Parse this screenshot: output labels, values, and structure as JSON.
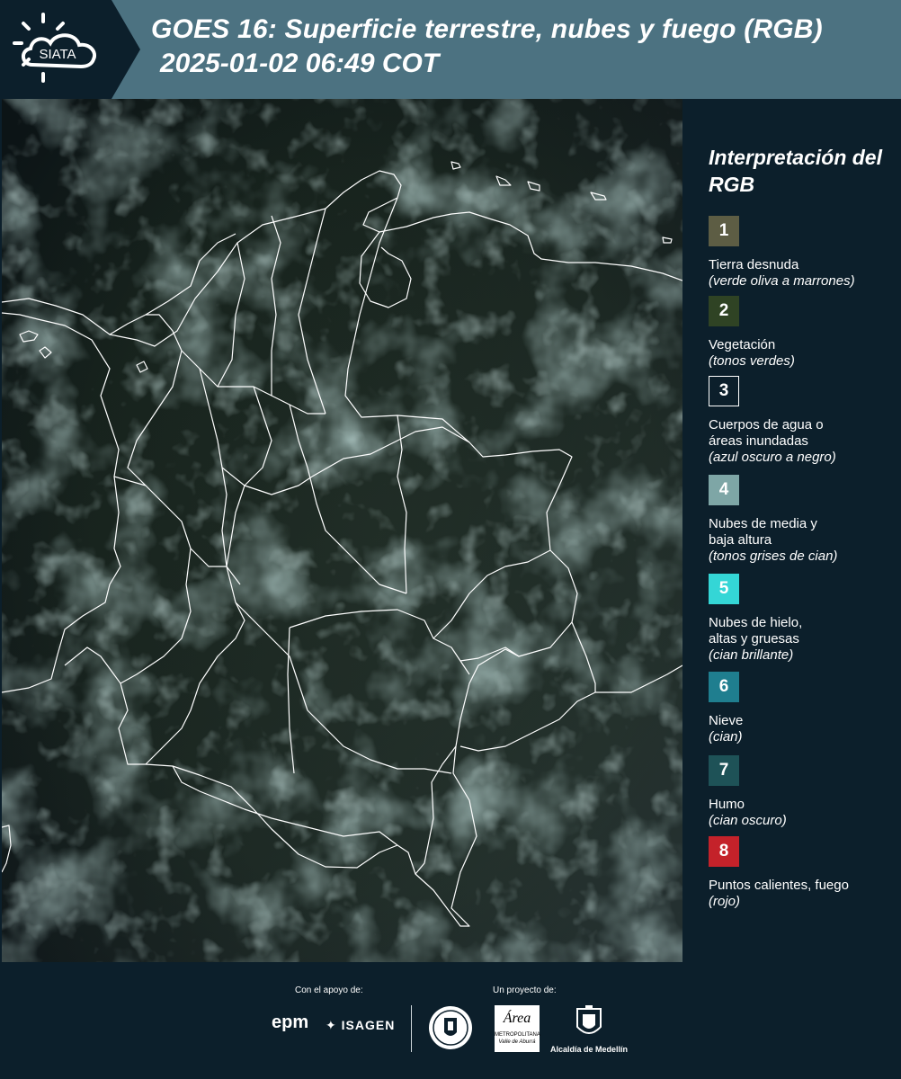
{
  "header": {
    "logo_text": "SIATA",
    "title_line1": "GOES 16: Superficie terrestre, nubes y fuego (RGB)",
    "title_line2": "2025-01-02 06:49 COT"
  },
  "map": {
    "description_icon": "satellite-map-image"
  },
  "legend": {
    "title": "Interpretación del RGB",
    "items": [
      {
        "number": "1",
        "color": "#5d5d44",
        "label": "Tierra desnuda",
        "sub": "(verde oliva a marrones)"
      },
      {
        "number": "2",
        "color": "#2f4324",
        "label": "Vegetación",
        "sub": "(tonos verdes)"
      },
      {
        "number": "3",
        "color": "#0c1f2b",
        "label": "Cuerpos de agua o áreas inundadas",
        "sub": "(azul oscuro a negro)"
      },
      {
        "number": "4",
        "color": "#7ea6a6",
        "label": "Nubes de media y baja altura",
        "sub": "(tonos grises de cian)"
      },
      {
        "number": "5",
        "color": "#34d6d6",
        "label": "Nubes de hielo, altas y gruesas",
        "sub": "(cian brillante)"
      },
      {
        "number": "6",
        "color": "#1f7e8f",
        "label": "Nieve",
        "sub": "(cian)"
      },
      {
        "number": "7",
        "color": "#1e5257",
        "label": "Humo",
        "sub": "(cian oscuro)"
      },
      {
        "number": "8",
        "color": "#c4222a",
        "label": "Puntos calientes, fuego",
        "sub": "(rojo)"
      }
    ]
  },
  "footer": {
    "support_label": "Con el apoyo de:",
    "project_label": "Un proyecto de:",
    "epm": "epm",
    "isagen": "ISAGEN",
    "area_name": "Área",
    "area_sub": "METROPOLITANA",
    "area_sub2": "Valle de Aburrá",
    "medellin": "Alcaldía de Medellín"
  }
}
